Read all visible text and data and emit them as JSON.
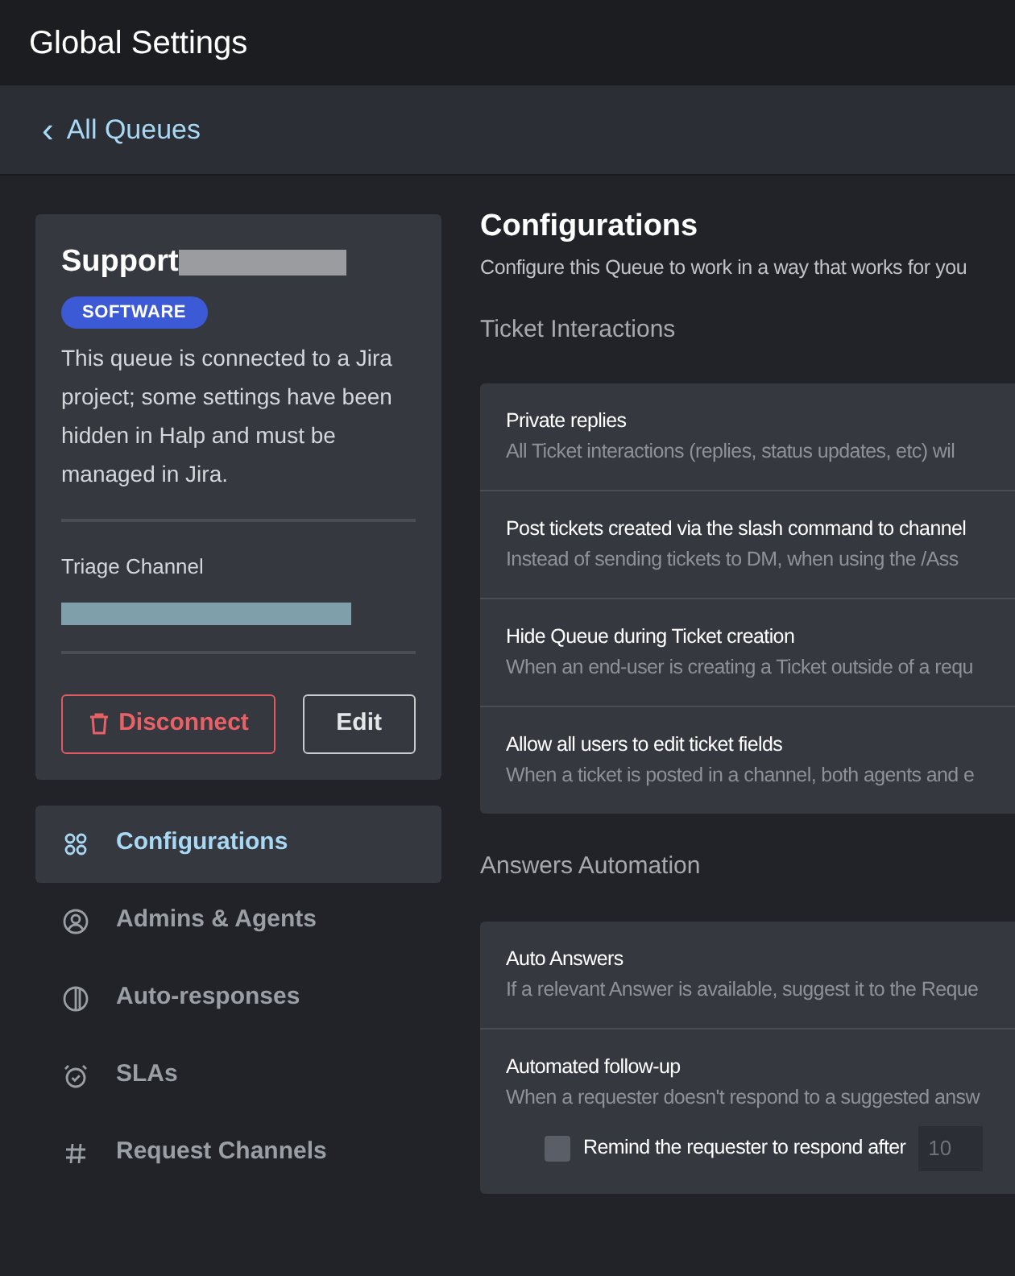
{
  "window": {
    "title": "Global Settings"
  },
  "back_link": {
    "icon": "‹",
    "label": "All Queues"
  },
  "queue_card": {
    "name": "Support",
    "badge": "SOFTWARE",
    "description": "This queue is connected to a Jira project; some settings have been hidden in Halp and must be managed in Jira.",
    "triage_label": "Triage Channel",
    "buttons": [
      {
        "kind": "danger",
        "label": "Disconnect"
      },
      {
        "kind": "outline",
        "label": "Edit"
      }
    ]
  },
  "sidebar": {
    "items": [
      {
        "label": "Configurations",
        "selected": true
      },
      {
        "label": "Admins & Agents",
        "selected": false
      },
      {
        "label": "Auto-responses",
        "selected": false
      },
      {
        "label": "SLAs",
        "selected": false
      },
      {
        "label": "Request Channels",
        "selected": false
      }
    ]
  },
  "main": {
    "title": "Configurations",
    "subtitle": "Configure this Queue to work in a way that works for you",
    "sections": [
      {
        "heading": "Ticket Interactions",
        "settings": [
          {
            "title": "Private replies",
            "description": "All Ticket interactions (replies, status updates, etc) wil"
          },
          {
            "title": "Post tickets created via the slash command to channel",
            "description": "Instead of sending tickets to DM, when using the /Ass"
          },
          {
            "title": "Hide Queue during Ticket creation",
            "description": "When an end-user is creating a Ticket outside of a requ"
          },
          {
            "title": "Allow all users to edit ticket fields",
            "description": "When a ticket is posted in a channel, both agents and e"
          }
        ]
      },
      {
        "heading": "Answers Automation",
        "settings": [
          {
            "title": "Auto Answers",
            "description": "If a relevant Answer is available, suggest it to the Reque"
          },
          {
            "title": "Automated follow-up",
            "description": "When a requester doesn't respond to a suggested answ",
            "option": {
              "label": "Remind the requester to respond after",
              "checked": false,
              "value": "10"
            }
          }
        ]
      }
    ]
  }
}
